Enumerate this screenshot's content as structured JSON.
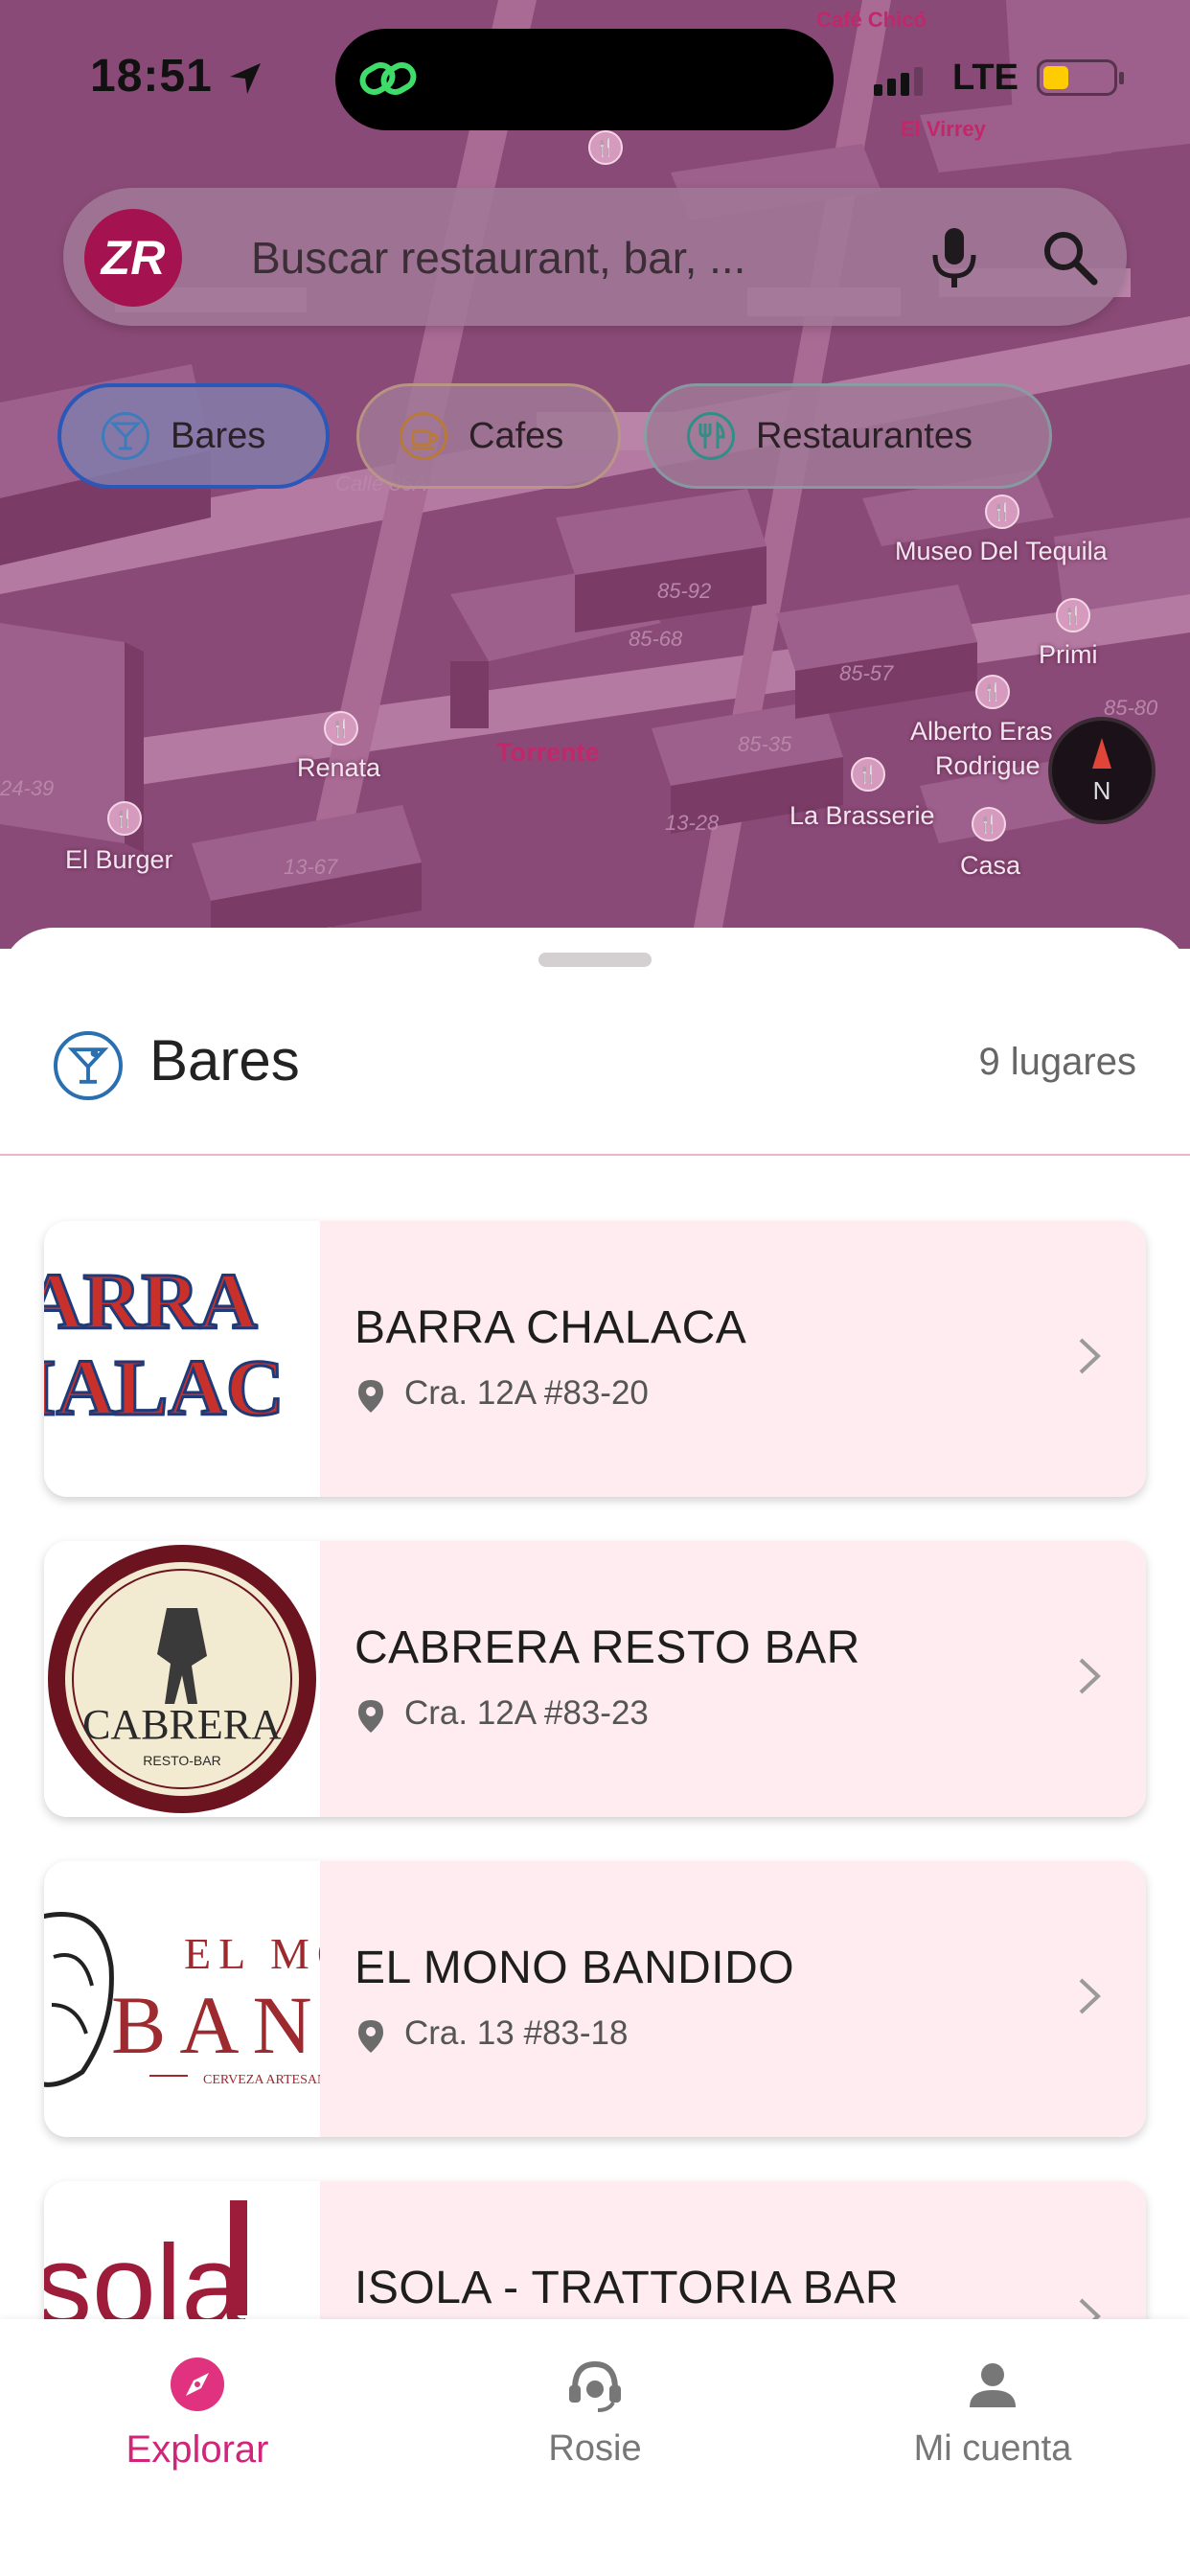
{
  "status": {
    "time": "18:51",
    "network": "LTE"
  },
  "search": {
    "placeholder": "Buscar restaurant, bar, ..."
  },
  "chips": [
    {
      "label": "Bares",
      "icon": "cocktail-icon",
      "selected": true
    },
    {
      "label": "Cafes",
      "icon": "coffee-cup-icon",
      "selected": false
    },
    {
      "label": "Restaurantes",
      "icon": "cutlery-icon",
      "selected": false
    }
  ],
  "map": {
    "labels": [
      "Calle 86A",
      "Museo Del Tequila",
      "Primi",
      "Alberto Eras",
      "Rodrigue",
      "Renata",
      "Torrente",
      "La Brasserie",
      "Casa",
      "El Burger",
      "Café Chicó",
      "El Virrey"
    ],
    "numbers": [
      "85-92",
      "85-68",
      "85-57",
      "85-35",
      "85-80",
      "13-28",
      "13-67",
      "24-39"
    ],
    "compass": "N"
  },
  "sheet": {
    "title": "Bares",
    "count": "9 lugares",
    "items": [
      {
        "name": "BARRA CHALACA",
        "address": "Cra. 12A #83-20",
        "logo_text": "ARRA\nIALAC"
      },
      {
        "name": "CABRERA RESTO BAR",
        "address": "Cra. 12A #83-23",
        "logo_text": "CABRERA",
        "logo_sub": "RESTO-BAR"
      },
      {
        "name": "EL MONO BANDIDO",
        "address": "Cra. 13 #83-18",
        "logo_text": "EL MO",
        "logo_text2": "BAND",
        "logo_sub": "CERVEZA ARTESAN"
      },
      {
        "name": "ISOLA - TRATTORIA BAR",
        "address": "",
        "logo_text": "sola"
      }
    ]
  },
  "tabbar": {
    "tabs": [
      {
        "label": "Explorar",
        "icon": "compass-icon",
        "active": true
      },
      {
        "label": "Rosie",
        "icon": "headset-icon",
        "active": false
      },
      {
        "label": "Mi cuenta",
        "icon": "user-icon",
        "active": false
      }
    ]
  },
  "colors": {
    "accent": "#d1257a",
    "brand": "#a4134f",
    "card_bg": "#feecf0",
    "chip_selected_border": "#2a57b8"
  }
}
